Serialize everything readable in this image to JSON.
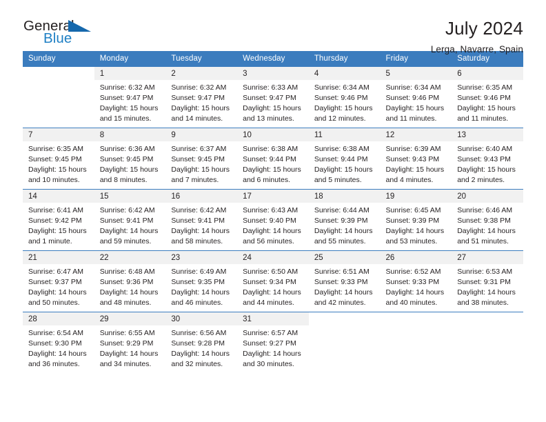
{
  "brand": {
    "name_top": "General",
    "name_bottom": "Blue",
    "accent_color": "#1668ac",
    "text_color": "#231f20"
  },
  "header": {
    "title": "July 2024",
    "subtitle": "Lerga, Navarre, Spain"
  },
  "calendar": {
    "header_bg": "#3b7cbe",
    "header_text_color": "#ffffff",
    "daynum_bg": "#f1f1f1",
    "weekdays": [
      "Sunday",
      "Monday",
      "Tuesday",
      "Wednesday",
      "Thursday",
      "Friday",
      "Saturday"
    ],
    "weeks": [
      [
        {
          "day": "",
          "sunrise": "",
          "sunset": "",
          "daylight": "",
          "empty": true
        },
        {
          "day": "1",
          "sunrise": "Sunrise: 6:32 AM",
          "sunset": "Sunset: 9:47 PM",
          "daylight": "Daylight: 15 hours and 15 minutes."
        },
        {
          "day": "2",
          "sunrise": "Sunrise: 6:32 AM",
          "sunset": "Sunset: 9:47 PM",
          "daylight": "Daylight: 15 hours and 14 minutes."
        },
        {
          "day": "3",
          "sunrise": "Sunrise: 6:33 AM",
          "sunset": "Sunset: 9:47 PM",
          "daylight": "Daylight: 15 hours and 13 minutes."
        },
        {
          "day": "4",
          "sunrise": "Sunrise: 6:34 AM",
          "sunset": "Sunset: 9:46 PM",
          "daylight": "Daylight: 15 hours and 12 minutes."
        },
        {
          "day": "5",
          "sunrise": "Sunrise: 6:34 AM",
          "sunset": "Sunset: 9:46 PM",
          "daylight": "Daylight: 15 hours and 11 minutes."
        },
        {
          "day": "6",
          "sunrise": "Sunrise: 6:35 AM",
          "sunset": "Sunset: 9:46 PM",
          "daylight": "Daylight: 15 hours and 11 minutes."
        }
      ],
      [
        {
          "day": "7",
          "sunrise": "Sunrise: 6:35 AM",
          "sunset": "Sunset: 9:45 PM",
          "daylight": "Daylight: 15 hours and 10 minutes."
        },
        {
          "day": "8",
          "sunrise": "Sunrise: 6:36 AM",
          "sunset": "Sunset: 9:45 PM",
          "daylight": "Daylight: 15 hours and 8 minutes."
        },
        {
          "day": "9",
          "sunrise": "Sunrise: 6:37 AM",
          "sunset": "Sunset: 9:45 PM",
          "daylight": "Daylight: 15 hours and 7 minutes."
        },
        {
          "day": "10",
          "sunrise": "Sunrise: 6:38 AM",
          "sunset": "Sunset: 9:44 PM",
          "daylight": "Daylight: 15 hours and 6 minutes."
        },
        {
          "day": "11",
          "sunrise": "Sunrise: 6:38 AM",
          "sunset": "Sunset: 9:44 PM",
          "daylight": "Daylight: 15 hours and 5 minutes."
        },
        {
          "day": "12",
          "sunrise": "Sunrise: 6:39 AM",
          "sunset": "Sunset: 9:43 PM",
          "daylight": "Daylight: 15 hours and 4 minutes."
        },
        {
          "day": "13",
          "sunrise": "Sunrise: 6:40 AM",
          "sunset": "Sunset: 9:43 PM",
          "daylight": "Daylight: 15 hours and 2 minutes."
        }
      ],
      [
        {
          "day": "14",
          "sunrise": "Sunrise: 6:41 AM",
          "sunset": "Sunset: 9:42 PM",
          "daylight": "Daylight: 15 hours and 1 minute."
        },
        {
          "day": "15",
          "sunrise": "Sunrise: 6:42 AM",
          "sunset": "Sunset: 9:41 PM",
          "daylight": "Daylight: 14 hours and 59 minutes."
        },
        {
          "day": "16",
          "sunrise": "Sunrise: 6:42 AM",
          "sunset": "Sunset: 9:41 PM",
          "daylight": "Daylight: 14 hours and 58 minutes."
        },
        {
          "day": "17",
          "sunrise": "Sunrise: 6:43 AM",
          "sunset": "Sunset: 9:40 PM",
          "daylight": "Daylight: 14 hours and 56 minutes."
        },
        {
          "day": "18",
          "sunrise": "Sunrise: 6:44 AM",
          "sunset": "Sunset: 9:39 PM",
          "daylight": "Daylight: 14 hours and 55 minutes."
        },
        {
          "day": "19",
          "sunrise": "Sunrise: 6:45 AM",
          "sunset": "Sunset: 9:39 PM",
          "daylight": "Daylight: 14 hours and 53 minutes."
        },
        {
          "day": "20",
          "sunrise": "Sunrise: 6:46 AM",
          "sunset": "Sunset: 9:38 PM",
          "daylight": "Daylight: 14 hours and 51 minutes."
        }
      ],
      [
        {
          "day": "21",
          "sunrise": "Sunrise: 6:47 AM",
          "sunset": "Sunset: 9:37 PM",
          "daylight": "Daylight: 14 hours and 50 minutes."
        },
        {
          "day": "22",
          "sunrise": "Sunrise: 6:48 AM",
          "sunset": "Sunset: 9:36 PM",
          "daylight": "Daylight: 14 hours and 48 minutes."
        },
        {
          "day": "23",
          "sunrise": "Sunrise: 6:49 AM",
          "sunset": "Sunset: 9:35 PM",
          "daylight": "Daylight: 14 hours and 46 minutes."
        },
        {
          "day": "24",
          "sunrise": "Sunrise: 6:50 AM",
          "sunset": "Sunset: 9:34 PM",
          "daylight": "Daylight: 14 hours and 44 minutes."
        },
        {
          "day": "25",
          "sunrise": "Sunrise: 6:51 AM",
          "sunset": "Sunset: 9:33 PM",
          "daylight": "Daylight: 14 hours and 42 minutes."
        },
        {
          "day": "26",
          "sunrise": "Sunrise: 6:52 AM",
          "sunset": "Sunset: 9:33 PM",
          "daylight": "Daylight: 14 hours and 40 minutes."
        },
        {
          "day": "27",
          "sunrise": "Sunrise: 6:53 AM",
          "sunset": "Sunset: 9:31 PM",
          "daylight": "Daylight: 14 hours and 38 minutes."
        }
      ],
      [
        {
          "day": "28",
          "sunrise": "Sunrise: 6:54 AM",
          "sunset": "Sunset: 9:30 PM",
          "daylight": "Daylight: 14 hours and 36 minutes."
        },
        {
          "day": "29",
          "sunrise": "Sunrise: 6:55 AM",
          "sunset": "Sunset: 9:29 PM",
          "daylight": "Daylight: 14 hours and 34 minutes."
        },
        {
          "day": "30",
          "sunrise": "Sunrise: 6:56 AM",
          "sunset": "Sunset: 9:28 PM",
          "daylight": "Daylight: 14 hours and 32 minutes."
        },
        {
          "day": "31",
          "sunrise": "Sunrise: 6:57 AM",
          "sunset": "Sunset: 9:27 PM",
          "daylight": "Daylight: 14 hours and 30 minutes."
        },
        {
          "day": "",
          "sunrise": "",
          "sunset": "",
          "daylight": "",
          "empty": true
        },
        {
          "day": "",
          "sunrise": "",
          "sunset": "",
          "daylight": "",
          "empty": true
        },
        {
          "day": "",
          "sunrise": "",
          "sunset": "",
          "daylight": "",
          "empty": true
        }
      ]
    ]
  }
}
